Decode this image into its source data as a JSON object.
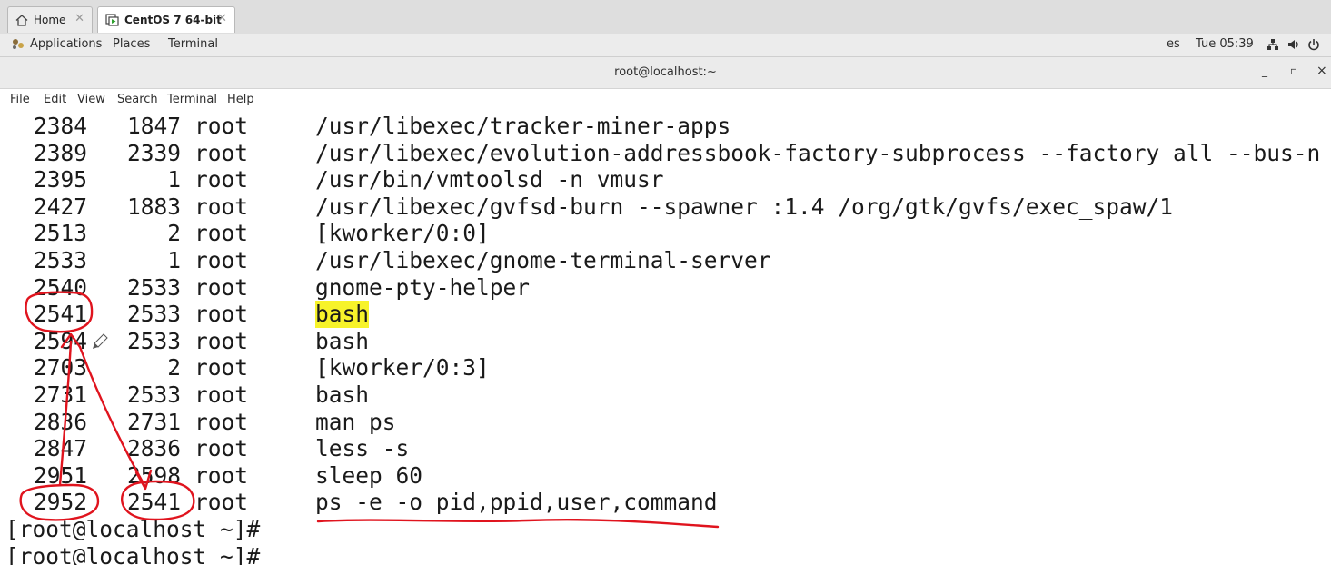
{
  "vm_tabs": [
    {
      "label": "Home",
      "icon": "home-icon"
    },
    {
      "label": "CentOS 7 64-bit",
      "icon": "vm-play-icon"
    }
  ],
  "gnome_panel": {
    "applications": "Applications",
    "places": "Places",
    "terminal": "Terminal",
    "input_lang": "es",
    "clock": "Tue 05:39"
  },
  "window": {
    "title": "root@localhost:~",
    "minimize": "_",
    "maximize": "▫",
    "close": "×"
  },
  "menu": [
    "File",
    "Edit",
    "View",
    "Search",
    "Terminal",
    "Help"
  ],
  "terminal": {
    "processes": [
      {
        "pid": "2384",
        "ppid": "1847",
        "user": "root",
        "command": "/usr/libexec/tracker-miner-apps"
      },
      {
        "pid": "2389",
        "ppid": "2339",
        "user": "root",
        "command": "/usr/libexec/evolution-addressbook-factory-subprocess --factory all --bus-n"
      },
      {
        "pid": "2395",
        "ppid": "1",
        "user": "root",
        "command": "/usr/bin/vmtoolsd -n vmusr"
      },
      {
        "pid": "2427",
        "ppid": "1883",
        "user": "root",
        "command": "/usr/libexec/gvfsd-burn --spawner :1.4 /org/gtk/gvfs/exec_spaw/1"
      },
      {
        "pid": "2513",
        "ppid": "2",
        "user": "root",
        "command": "[kworker/0:0]"
      },
      {
        "pid": "2533",
        "ppid": "1",
        "user": "root",
        "command": "/usr/libexec/gnome-terminal-server"
      },
      {
        "pid": "2540",
        "ppid": "2533",
        "user": "root",
        "command": "gnome-pty-helper"
      },
      {
        "pid": "2541",
        "ppid": "2533",
        "user": "root",
        "command": "bash",
        "highlight": true
      },
      {
        "pid": "2594",
        "ppid": "2533",
        "user": "root",
        "command": "bash"
      },
      {
        "pid": "2703",
        "ppid": "2",
        "user": "root",
        "command": "[kworker/0:3]"
      },
      {
        "pid": "2731",
        "ppid": "2533",
        "user": "root",
        "command": "bash"
      },
      {
        "pid": "2836",
        "ppid": "2731",
        "user": "root",
        "command": "man ps"
      },
      {
        "pid": "2847",
        "ppid": "2836",
        "user": "root",
        "command": "less -s"
      },
      {
        "pid": "2951",
        "ppid": "2598",
        "user": "root",
        "command": "sleep 60"
      },
      {
        "pid": "2952",
        "ppid": "2541",
        "user": "root",
        "command": "ps -e -o pid,ppid,user,command"
      }
    ],
    "prompts": [
      "[root@localhost ~]#",
      "[root@localhost ~]#"
    ]
  },
  "colors": {
    "highlight": "#f7f32a",
    "annotation": "#e0141e",
    "text": "#1a1a1a"
  }
}
